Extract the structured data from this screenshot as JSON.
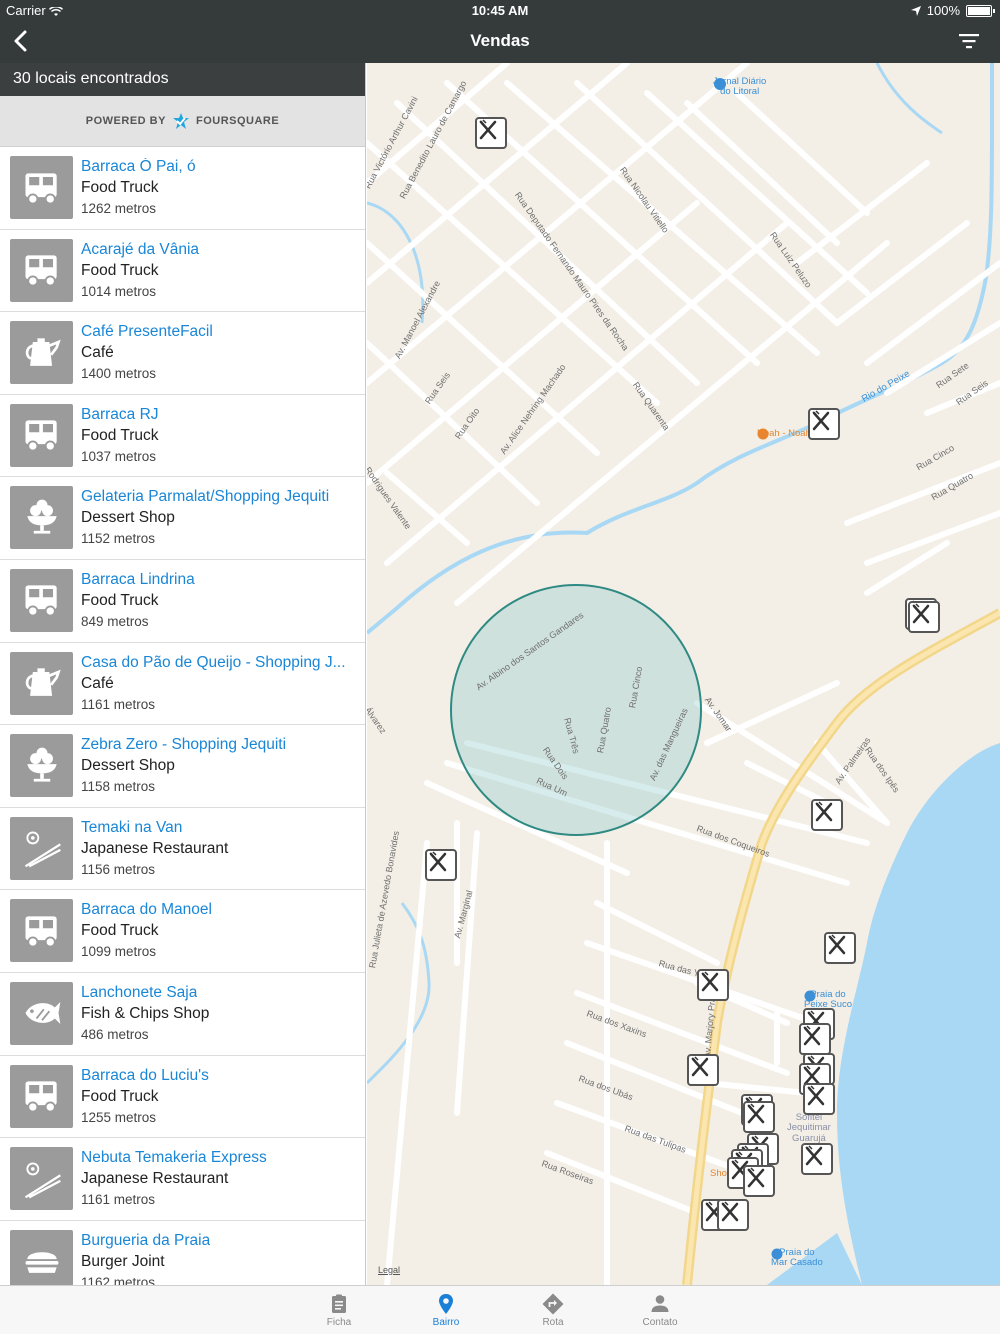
{
  "status": {
    "carrier": "Carrier",
    "time": "10:45 AM",
    "battery": "100%"
  },
  "nav": {
    "title": "Vendas",
    "back_icon": "chevron-left-icon",
    "filter_icon": "filter-icon"
  },
  "results": {
    "count_text": "30 locais encontrados",
    "powered_by": "POWERED BY",
    "brand": "FOURSQUARE"
  },
  "venues": [
    {
      "name": "Barraca Ó Pai, ó",
      "category": "Food Truck",
      "distance": "1262 metros",
      "icon": "truck"
    },
    {
      "name": "Acarajé da Vânia",
      "category": "Food Truck",
      "distance": "1014 metros",
      "icon": "truck"
    },
    {
      "name": "Café PresenteFacil",
      "category": "Café",
      "distance": "1400 metros",
      "icon": "kettle"
    },
    {
      "name": "Barraca RJ",
      "category": "Food Truck",
      "distance": "1037 metros",
      "icon": "truck"
    },
    {
      "name": "Gelateria Parmalat/Shopping Jequiti",
      "category": "Dessert Shop",
      "distance": "1152 metros",
      "icon": "dessert"
    },
    {
      "name": "Barraca Lindrina",
      "category": "Food Truck",
      "distance": "849 metros",
      "icon": "truck"
    },
    {
      "name": "Casa do Pão de Queijo - Shopping J...",
      "category": "Café",
      "distance": "1161 metros",
      "icon": "kettle"
    },
    {
      "name": "Zebra Zero - Shopping Jequiti",
      "category": "Dessert Shop",
      "distance": "1158 metros",
      "icon": "dessert"
    },
    {
      "name": "Temaki na Van",
      "category": "Japanese Restaurant",
      "distance": "1156 metros",
      "icon": "chopsticks"
    },
    {
      "name": "Barraca do Manoel",
      "category": "Food Truck",
      "distance": "1099 metros",
      "icon": "truck"
    },
    {
      "name": "Lanchonete Saja",
      "category": "Fish & Chips Shop",
      "distance": "486 metros",
      "icon": "fish"
    },
    {
      "name": "Barraca do Luciu's",
      "category": "Food Truck",
      "distance": "1255 metros",
      "icon": "truck"
    },
    {
      "name": "Nebuta Temakeria Express",
      "category": "Japanese Restaurant",
      "distance": "1161 metros",
      "icon": "chopsticks"
    },
    {
      "name": "Burgueria da Praia",
      "category": "Burger Joint",
      "distance": "1162 metros",
      "icon": "burger"
    }
  ],
  "map": {
    "legal": "Legal",
    "places": {
      "jornal": "Jornal Diário\ndo Litoral",
      "noah": "Noah - Noah",
      "praia_peixe": "Praia do\nPeixe Suco",
      "sofitel": "Sofitel\nJequitimar\nGuarujá",
      "praia_mar": "Praia do\nMar Casado",
      "shop": "Sho"
    },
    "river": "Rio do Peixe",
    "streets": [
      "Rua Victório Arthur Cavini",
      "Rua Benedito Lauro de Camargo",
      "Rua Nicolau Vitiello",
      "Rua Deputado Fernando Mauro Pires da Rocha",
      "Rua Luiz Peluzo",
      "Av. Manoel Alexandre",
      "Rua Seis",
      "Rua Oito",
      "Av. Alice Nehring Machado",
      "Rua Quarenta",
      "Rua Sete",
      "Rua Seis",
      "Rua Cinco",
      "Rua Quatro",
      "Av. Albino dos Santos Gandares",
      "Rua Três",
      "Rua Quatro",
      "Rua Cinco",
      "Rua Dois",
      "Rua Um",
      "Av. das Mangueiras",
      "Av. Jomar",
      "Av. Palmeiras",
      "Rua dos Ipês",
      "Rua dos Coqueiros",
      "Rua Julieta de Azevedo Bonavides",
      "Av. Marginal",
      "Rua das Y",
      "Rua dos Xaxins",
      "Av. Marjory Prado",
      "Rua dos Ubás",
      "Rua das Tulipas",
      "Rua Roseiras",
      "Rodrigues Valente",
      "Álvarez"
    ]
  },
  "tabs": [
    {
      "label": "Ficha",
      "icon": "clipboard-icon",
      "active": false
    },
    {
      "label": "Bairro",
      "icon": "location-pin-icon",
      "active": true
    },
    {
      "label": "Rota",
      "icon": "route-icon",
      "active": false
    },
    {
      "label": "Contato",
      "icon": "person-icon",
      "active": false
    }
  ],
  "colors": {
    "nav_bg": "#353b3b",
    "link": "#1a86d6",
    "map_land": "#f3efe6",
    "water": "#a9d8f5",
    "radius": "#2f8a84"
  }
}
